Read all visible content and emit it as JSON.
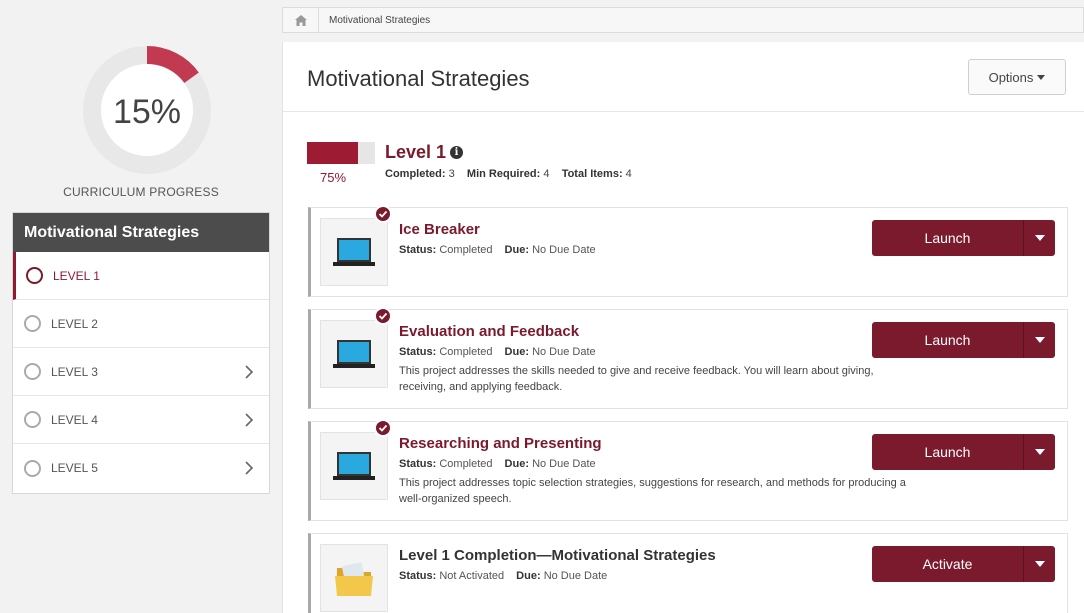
{
  "breadcrumb": {
    "current": "Motivational Strategies"
  },
  "progress": {
    "percent_label": "15%",
    "fraction": 0.15,
    "caption": "CURRICULUM PROGRESS",
    "ring_color": "#c23a52"
  },
  "sidebar": {
    "title": "Motivational Strategies",
    "items": [
      {
        "label": "LEVEL 1"
      },
      {
        "label": "LEVEL 2"
      },
      {
        "label": "LEVEL 3"
      },
      {
        "label": "LEVEL 4"
      },
      {
        "label": "LEVEL 5"
      }
    ]
  },
  "header": {
    "title": "Motivational Strategies",
    "options_label": "Options"
  },
  "level": {
    "title": "Level 1",
    "percent_label": "75%",
    "fraction": 0.75,
    "completed_label": "Completed:",
    "completed_value": "3",
    "min_label": "Min Required:",
    "min_value": "4",
    "total_label": "Total Items:",
    "total_value": "4"
  },
  "items": [
    {
      "title": "Ice Breaker",
      "status_label": "Status:",
      "status": "Completed",
      "due_label": "Due:",
      "due": "No Due Date",
      "description": "",
      "button": "Launch"
    },
    {
      "title": "Evaluation and Feedback",
      "status_label": "Status:",
      "status": "Completed",
      "due_label": "Due:",
      "due": "No Due Date",
      "description": "This project addresses the skills needed to give and receive feedback. You will learn about giving, receiving, and applying feedback.",
      "button": "Launch"
    },
    {
      "title": "Researching and Presenting",
      "status_label": "Status:",
      "status": "Completed",
      "due_label": "Due:",
      "due": "No Due Date",
      "description": "This project addresses topic selection strategies, suggestions for research, and methods for producing a well-organized speech.",
      "button": "Launch"
    },
    {
      "title": "Level 1 Completion—Motivational Strategies",
      "status_label": "Status:",
      "status": "Not Activated",
      "due_label": "Due:",
      "due": "No Due Date",
      "description": "",
      "button": "Activate"
    }
  ],
  "colors": {
    "brand": "#7a1a2c",
    "level_bar": "#9e1c33",
    "sidebar_header": "#4c4c4c"
  }
}
